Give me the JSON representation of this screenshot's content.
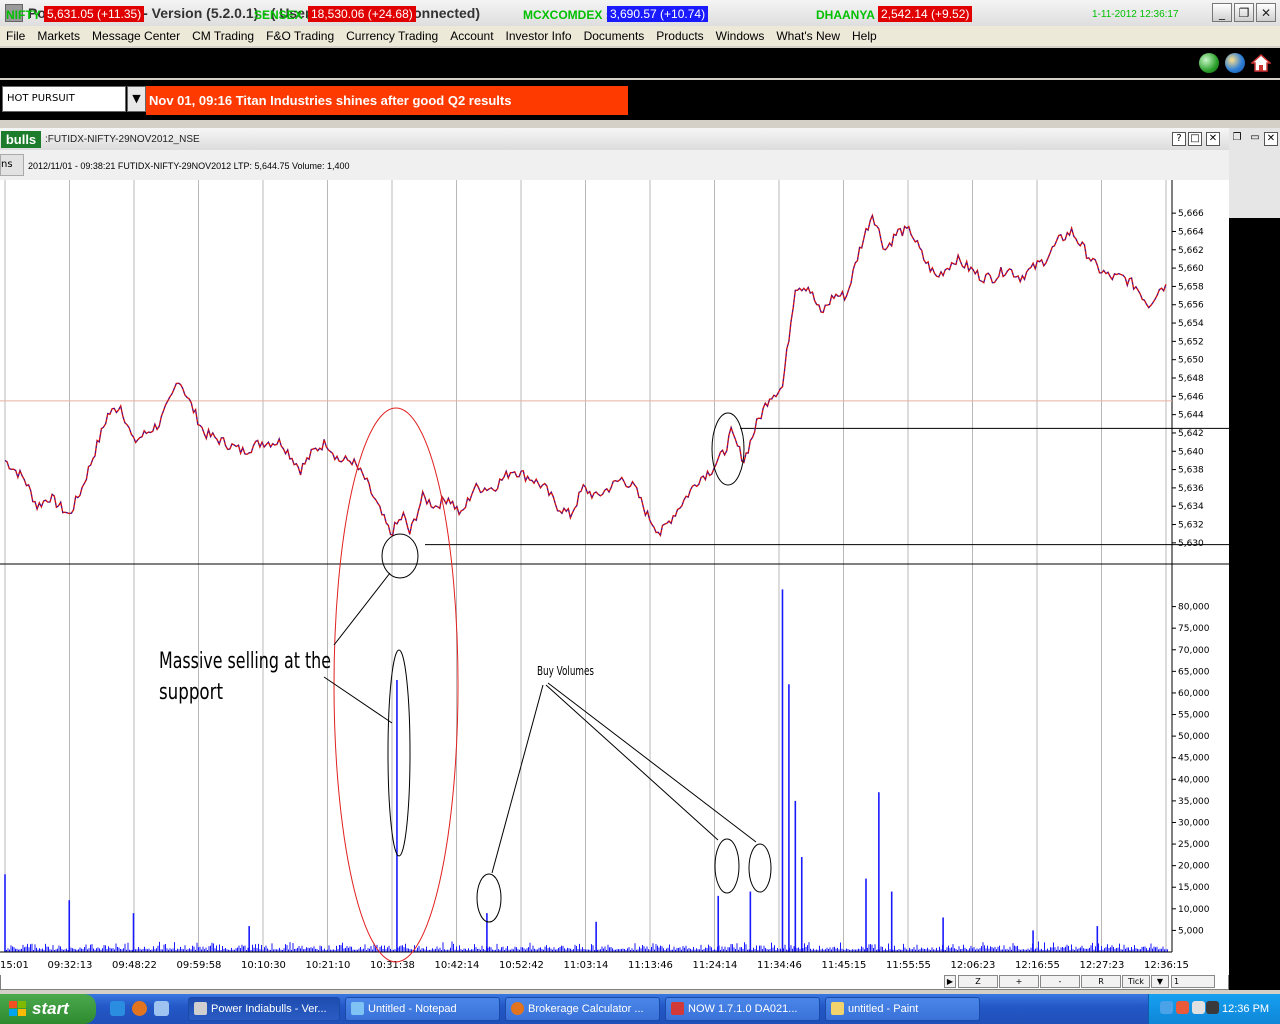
{
  "window": {
    "title": "Power Indiabulls - Version (5.2.0.1) - ( User ID - SL2351) (Connected)",
    "controls": {
      "minimize": "_",
      "restore": "❐",
      "close": "✕"
    }
  },
  "menu": [
    "File",
    "Markets",
    "Message Center",
    "CM Trading",
    "F&O Trading",
    "Currency Trading",
    "Account",
    "Investor Info",
    "Documents",
    "Products",
    "Windows",
    "What's New",
    "Help"
  ],
  "ticker": {
    "items": [
      {
        "label": "NIFTY :",
        "value": "5,631.05 (+11.35)",
        "color": "#e00000"
      },
      {
        "label": "SENSEX :",
        "value": "18,530.06 (+24.68)",
        "color": "#e00000"
      },
      {
        "label": "MCXCOMDEX :",
        "value": "3,690.57 (+10.74)",
        "color": "#1a1aff"
      },
      {
        "label": "DHAANYA :",
        "value": "2,542.14 (+9.52)",
        "color": "#e00000"
      }
    ],
    "datetime": "1-11-2012 12:36:17"
  },
  "hot_pursuit": {
    "selected": "HOT PURSUIT",
    "headline": "Nov 01, 09:16 Titan Industries shines after good Q2 results"
  },
  "chart_window": {
    "logo": "bulls",
    "title": ":FUTIDX-NIFTY-29NOV2012_NSE",
    "tab_label": "ns",
    "info": "2012/11/01 - 09:38:21 FUTIDX-NIFTY-29NOV2012 LTP: 5,644.75 Volume: 1,400",
    "buttons": [
      "?",
      "□",
      "✕"
    ]
  },
  "annotations": {
    "massive_line1": "Massive selling at the",
    "massive_line2": "support",
    "buy_volumes": "Buy Volumes"
  },
  "bottom_toolbar": [
    "Z",
    "+",
    "-",
    "",
    "R",
    "Tick",
    "1"
  ],
  "taskbar": {
    "start": "start",
    "buttons": [
      "Power Indiabulls - Ver...",
      "Untitled - Notepad",
      "Brokerage Calculator ...",
      "NOW 1.7.1.0 DA021...",
      "untitled - Paint"
    ],
    "clock": "12:36 PM"
  },
  "chart_data": {
    "type": "line",
    "price_axis": {
      "ticks": [
        "5,666",
        "5,664",
        "5,662",
        "5,660",
        "5,658",
        "5,656",
        "5,654",
        "5,652",
        "5,650",
        "5,648",
        "5,646",
        "5,644",
        "5,642",
        "5,640",
        "5,638",
        "5,636",
        "5,634",
        "5,632",
        "5,630"
      ],
      "range": [
        5629,
        5667
      ]
    },
    "volume_axis": {
      "ticks": [
        "80,000",
        "75,000",
        "70,000",
        "65,000",
        "60,000",
        "55,000",
        "50,000",
        "45,000",
        "40,000",
        "35,000",
        "30,000",
        "25,000",
        "20,000",
        "15,000",
        "10,000",
        "5,000"
      ],
      "range": [
        0,
        85000
      ]
    },
    "time_ticks": [
      "15:01",
      "09:32:13",
      "09:48:22",
      "09:59:58",
      "10:10:30",
      "10:21:10",
      "10:31:38",
      "10:42:14",
      "10:52:42",
      "11:03:14",
      "11:13:46",
      "11:24:14",
      "11:34:46",
      "11:45:15",
      "11:55:55",
      "12:06:23",
      "12:16:55",
      "12:27:23",
      "12:36:15"
    ],
    "price_keypoints": [
      [
        0,
        5639
      ],
      [
        3,
        5637
      ],
      [
        5,
        5634
      ],
      [
        7,
        5635
      ],
      [
        10,
        5633
      ],
      [
        12,
        5636
      ],
      [
        14,
        5640
      ],
      [
        16,
        5644
      ],
      [
        18,
        5645
      ],
      [
        20,
        5641
      ],
      [
        22,
        5642
      ],
      [
        24,
        5643
      ],
      [
        26,
        5646
      ],
      [
        27,
        5648
      ],
      [
        29,
        5645
      ],
      [
        31,
        5642
      ],
      [
        34,
        5641
      ],
      [
        37,
        5640
      ],
      [
        40,
        5641
      ],
      [
        43,
        5641
      ],
      [
        46,
        5638
      ],
      [
        48,
        5640
      ],
      [
        50,
        5641
      ],
      [
        52,
        5639
      ],
      [
        54,
        5639
      ],
      [
        56,
        5637
      ],
      [
        58,
        5634
      ],
      [
        60,
        5631
      ],
      [
        62,
        5633
      ],
      [
        63,
        5631
      ],
      [
        65,
        5635
      ],
      [
        67,
        5634
      ],
      [
        69,
        5635
      ],
      [
        71,
        5633
      ],
      [
        73,
        5636
      ],
      [
        76,
        5636
      ],
      [
        79,
        5638
      ],
      [
        82,
        5637
      ],
      [
        84,
        5636
      ],
      [
        86,
        5634
      ],
      [
        88,
        5633
      ],
      [
        90,
        5636
      ],
      [
        92,
        5635
      ],
      [
        94,
        5636
      ],
      [
        96,
        5637
      ],
      [
        98,
        5636
      ],
      [
        100,
        5633
      ],
      [
        102,
        5631
      ],
      [
        104,
        5633
      ],
      [
        106,
        5635
      ],
      [
        108,
        5637
      ],
      [
        110,
        5638
      ],
      [
        112,
        5640
      ],
      [
        113,
        5642
      ],
      [
        115,
        5639
      ],
      [
        117,
        5643
      ],
      [
        119,
        5646
      ],
      [
        121,
        5647
      ],
      [
        123,
        5658
      ],
      [
        125,
        5658
      ],
      [
        127,
        5655
      ],
      [
        129,
        5657
      ],
      [
        131,
        5657
      ],
      [
        133,
        5662
      ],
      [
        135,
        5666
      ],
      [
        137,
        5662
      ],
      [
        139,
        5664
      ],
      [
        141,
        5664
      ],
      [
        143,
        5661
      ],
      [
        145,
        5659
      ],
      [
        148,
        5661
      ],
      [
        150,
        5660
      ],
      [
        152,
        5659
      ],
      [
        154,
        5659
      ],
      [
        156,
        5660
      ],
      [
        158,
        5659
      ],
      [
        160,
        5660
      ],
      [
        162,
        5661
      ],
      [
        164,
        5663
      ],
      [
        166,
        5664
      ],
      [
        168,
        5662
      ],
      [
        170,
        5660
      ],
      [
        172,
        5659
      ],
      [
        174,
        5659
      ],
      [
        176,
        5658
      ],
      [
        178,
        5656
      ],
      [
        180,
        5658
      ],
      [
        181,
        5658
      ]
    ],
    "volume_spikes": [
      [
        0,
        18000
      ],
      [
        10,
        12000
      ],
      [
        20,
        9000
      ],
      [
        38,
        6000
      ],
      [
        61,
        63000
      ],
      [
        75,
        9000
      ],
      [
        92,
        7000
      ],
      [
        111,
        13000
      ],
      [
        116,
        14000
      ],
      [
        121,
        84000
      ],
      [
        122,
        62000
      ],
      [
        123,
        35000
      ],
      [
        124,
        22000
      ],
      [
        134,
        17000
      ],
      [
        136,
        37000
      ],
      [
        138,
        14000
      ],
      [
        146,
        8000
      ],
      [
        160,
        5000
      ],
      [
        170,
        6000
      ]
    ],
    "horizontal_lines": [
      5642.5,
      5629.8
    ],
    "red_line": 5645.5
  }
}
